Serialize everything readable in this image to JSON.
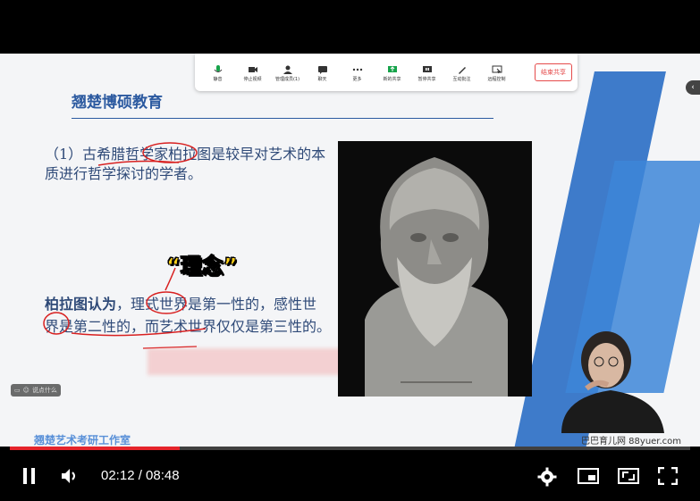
{
  "slide": {
    "title": "翘楚博硕教育",
    "para1": "（1）古希腊哲学家柏拉图是较早对艺术的本质进行哲学探讨的学者。",
    "para2_bold": "柏拉图认为",
    "para2_rest": "，理式世界是第一性的，感性世界是第二性的，而艺术世界仅仅是第三性的。",
    "subtitle_caption": "“理念”",
    "watermark_left": "翘楚艺术考研工作室",
    "watermark_right": "巴巴育儿网 88yuer.com",
    "chat_hint": "说点什么"
  },
  "toolbar": {
    "items": [
      {
        "label": "静音",
        "icon": "microphone-icon"
      },
      {
        "label": "停止视频",
        "icon": "camera-icon"
      },
      {
        "label": "管理成员(1)",
        "icon": "members-icon"
      },
      {
        "label": "聊天",
        "icon": "chat-icon"
      },
      {
        "label": "更多",
        "icon": "more-icon"
      },
      {
        "label": "新的共享",
        "icon": "share-icon"
      },
      {
        "label": "暂停共享",
        "icon": "pause-share-icon"
      },
      {
        "label": "互动批注",
        "icon": "annotate-icon"
      },
      {
        "label": "远程控制",
        "icon": "remote-control-icon"
      }
    ],
    "end_share": "结束共享"
  },
  "player": {
    "current_time": "02:12",
    "duration": "08:48",
    "time_display": "02:12 / 08:48",
    "progress_fraction": 0.25,
    "accent": "#e5242b"
  }
}
